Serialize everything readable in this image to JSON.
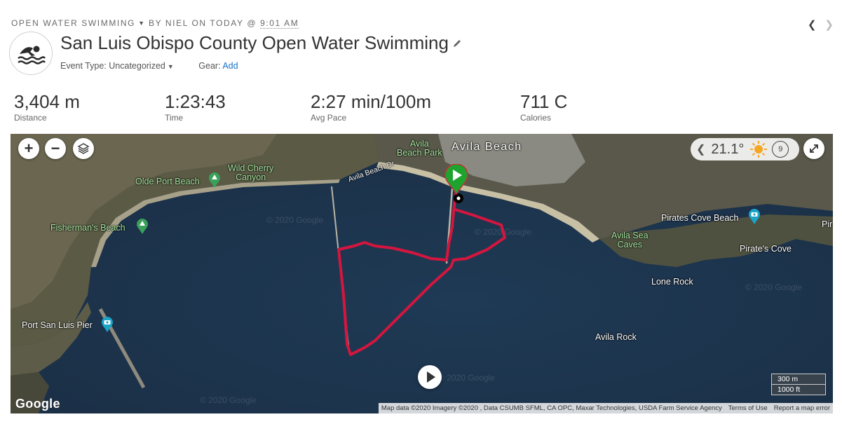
{
  "header": {
    "activity_type": "OPEN WATER SWIMMING",
    "by_text": "BY NIEL ON TODAY @",
    "time": "9:01 AM",
    "title": "San Luis Obispo County Open Water Swimming",
    "event_type": "Event Type: Uncategorized",
    "gear_label": "Gear:",
    "gear_link": "Add",
    "prev_icon": "chevron-left",
    "next_icon": "chevron-right"
  },
  "stats": [
    {
      "value": "3,404 m",
      "label": "Distance"
    },
    {
      "value": "1:23:43",
      "label": "Time"
    },
    {
      "value": "2:27 min/100m",
      "label": "Avg Pace"
    },
    {
      "value": "711 C",
      "label": "Calories"
    }
  ],
  "map": {
    "controls": {
      "zoom_in": "+",
      "zoom_out": "−",
      "layers_icon": "layers-icon"
    },
    "weather": {
      "temp": "21.1°",
      "wind": "9",
      "icon": "sun-icon"
    },
    "labels": {
      "avila_beach": "Avila Beach",
      "avila_beach_park": "Avila\nBeach Park",
      "avila_beach_dr": "Avila Beach Dr",
      "wild_cherry": "Wild Cherry\nCanyon",
      "olde_port": "Olde Port Beach",
      "fishermans": "Fisherman's Beach",
      "port_san_luis": "Port San Luis Pier",
      "pirates_cove_beach": "Pirates Cove Beach",
      "pirates_cove": "Pirate's Cove",
      "avila_sea_caves": "Avila Sea\nCaves",
      "lone_rock": "Lone Rock",
      "avila_rock": "Avila Rock",
      "edge_label": "Pir"
    },
    "watermark": "© 2020 Google",
    "scale": {
      "metric": "300 m",
      "imperial": "1000 ft"
    },
    "footer": {
      "attribution": "Map data ©2020 Imagery ©2020 , Data CSUMB SFML, CA OPC, Maxar Technologies, USDA Farm Service Agency",
      "terms": "Terms of Use",
      "report": "Report a map error"
    },
    "google_logo": "Google",
    "route_color": "#d4163f"
  }
}
